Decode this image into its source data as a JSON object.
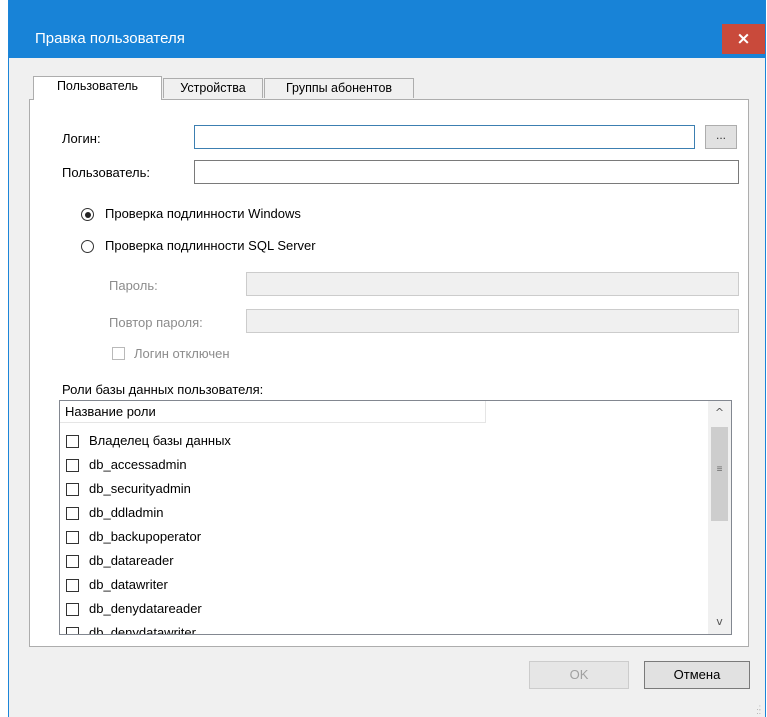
{
  "window": {
    "title": "Правка пользователя",
    "close_icon": "×"
  },
  "tabs": [
    {
      "label": "Пользователь",
      "active": true
    },
    {
      "label": "Устройства",
      "active": false
    },
    {
      "label": "Группы абонентов",
      "active": false
    }
  ],
  "form": {
    "login_label": "Логин:",
    "login_value": "",
    "browse_label": "...",
    "user_label": "Пользователь:",
    "user_value": "",
    "auth_windows_label": "Проверка подлинности Windows",
    "auth_windows_selected": true,
    "auth_sql_label": "Проверка подлинности SQL Server",
    "auth_sql_selected": false,
    "password_label": "Пароль:",
    "password_value": "",
    "confirm_password_label": "Повтор пароля:",
    "confirm_password_value": "",
    "login_disabled_label": "Логин отключен",
    "login_disabled_checked": false
  },
  "roles": {
    "section_label": "Роли базы данных пользователя:",
    "column_header": "Название роли",
    "items": [
      {
        "name": "Владелец базы данных",
        "checked": false
      },
      {
        "name": "db_accessadmin",
        "checked": false
      },
      {
        "name": "db_securityadmin",
        "checked": false
      },
      {
        "name": "db_ddladmin",
        "checked": false
      },
      {
        "name": "db_backupoperator",
        "checked": false
      },
      {
        "name": "db_datareader",
        "checked": false
      },
      {
        "name": "db_datawriter",
        "checked": false
      },
      {
        "name": "db_denydatareader",
        "checked": false
      },
      {
        "name": "db_denydatawriter",
        "checked": false
      }
    ]
  },
  "scrollbar": {
    "up_icon": "^",
    "down_icon": "v",
    "grip_icon": "≡"
  },
  "buttons": {
    "ok_label": "OK",
    "cancel_label": "Отмена"
  },
  "colors": {
    "titlebar": "#1883d7",
    "close": "#c94a3b",
    "focus_border": "#3c7fb1"
  }
}
